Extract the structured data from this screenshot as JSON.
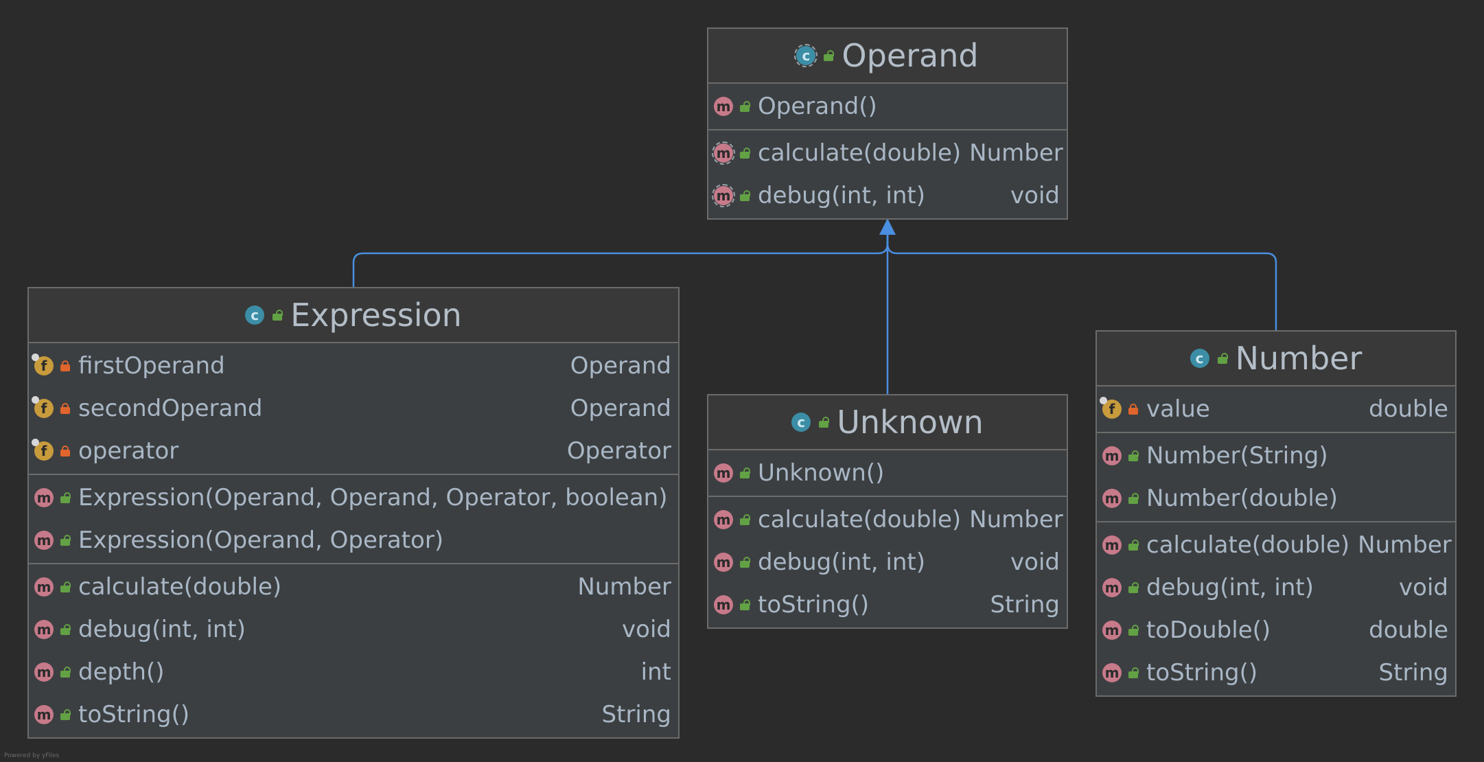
{
  "classes": {
    "operand": {
      "name": "Operand",
      "constructors": [
        {
          "name": "Operand()",
          "type": ""
        }
      ],
      "methods": [
        {
          "name": "calculate(double)",
          "type": "Number"
        },
        {
          "name": "debug(int, int)",
          "type": "void"
        }
      ]
    },
    "expression": {
      "name": "Expression",
      "fields": [
        {
          "name": "firstOperand",
          "type": "Operand"
        },
        {
          "name": "secondOperand",
          "type": "Operand"
        },
        {
          "name": "operator",
          "type": "Operator"
        }
      ],
      "constructors": [
        {
          "name": "Expression(Operand, Operand, Operator, boolean)",
          "type": ""
        },
        {
          "name": "Expression(Operand, Operator)",
          "type": ""
        }
      ],
      "methods": [
        {
          "name": "calculate(double)",
          "type": "Number"
        },
        {
          "name": "debug(int, int)",
          "type": "void"
        },
        {
          "name": "depth()",
          "type": "int"
        },
        {
          "name": "toString()",
          "type": "String"
        }
      ]
    },
    "unknown": {
      "name": "Unknown",
      "constructors": [
        {
          "name": "Unknown()",
          "type": ""
        }
      ],
      "methods": [
        {
          "name": "calculate(double)",
          "type": "Number"
        },
        {
          "name": "debug(int, int)",
          "type": "void"
        },
        {
          "name": "toString()",
          "type": "String"
        }
      ]
    },
    "number": {
      "name": "Number",
      "fields": [
        {
          "name": "value",
          "type": "double"
        }
      ],
      "constructors": [
        {
          "name": "Number(String)",
          "type": ""
        },
        {
          "name": "Number(double)",
          "type": ""
        }
      ],
      "methods": [
        {
          "name": "calculate(double)",
          "type": "Number"
        },
        {
          "name": "debug(int, int)",
          "type": "void"
        },
        {
          "name": "toDouble()",
          "type": "double"
        },
        {
          "name": "toString()",
          "type": "String"
        }
      ]
    }
  },
  "icons": {
    "class": "class-icon",
    "method": "method-icon",
    "field": "field-icon",
    "public": "public-lock-icon",
    "private": "private-lock-icon"
  },
  "colors": {
    "background": "#2b2b2b",
    "box": "#3c3f41",
    "edge": "#4a8fe0",
    "method_icon": "#c77a8a",
    "field_icon": "#c89b3c",
    "class_icon": "#3c8ea6"
  },
  "footer": "Powered by yFiles"
}
